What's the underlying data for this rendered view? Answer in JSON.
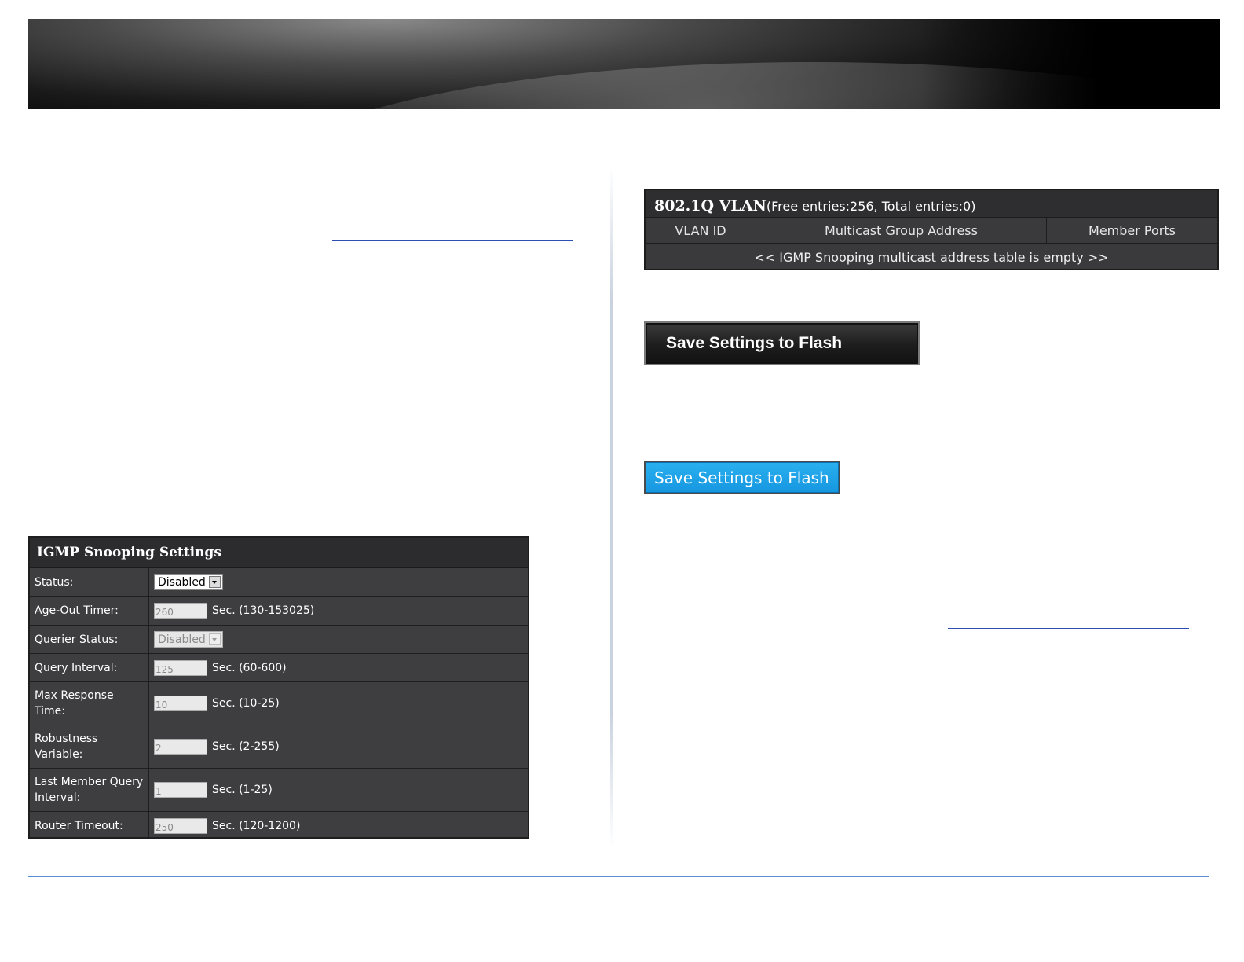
{
  "igmp_settings": {
    "title": "IGMP Snooping Settings",
    "rows": [
      {
        "label": "Status:",
        "type": "select",
        "value": "Disabled",
        "disabled": false
      },
      {
        "label": "Age-Out Timer:",
        "type": "input",
        "value": "260",
        "range": "Sec. (130-153025)"
      },
      {
        "label": "Querier Status:",
        "type": "select",
        "value": "Disabled",
        "disabled": true
      },
      {
        "label": "Query Interval:",
        "type": "input",
        "value": "125",
        "range": "Sec. (60-600)"
      },
      {
        "label": "Max Response Time:",
        "type": "input",
        "value": "10",
        "range": "Sec. (10-25)"
      },
      {
        "label": "Robustness Variable:",
        "type": "input",
        "value": "2",
        "range": "Sec. (2-255)"
      },
      {
        "label": "Last Member Query Interval:",
        "type": "input",
        "value": "1",
        "range": "Sec. (1-25)"
      },
      {
        "label": "Router Timeout:",
        "type": "input",
        "value": "250",
        "range": "Sec. (120-1200)"
      }
    ]
  },
  "vlan_table": {
    "title": "802.1Q VLAN",
    "entries_info": "(Free entries:256, Total entries:0)",
    "columns": [
      "VLAN ID",
      "Multicast Group Address",
      "Member Ports"
    ],
    "empty_message": "<< IGMP Snooping multicast address table is empty >>"
  },
  "buttons": {
    "save_dark_label": "Save Settings to Flash",
    "save_blue_label": "Save Settings to Flash"
  },
  "colors": {
    "panel_bg": "#3e3e41",
    "blue_button": "#1696e0",
    "footer_rule": "#5b8fd1"
  }
}
